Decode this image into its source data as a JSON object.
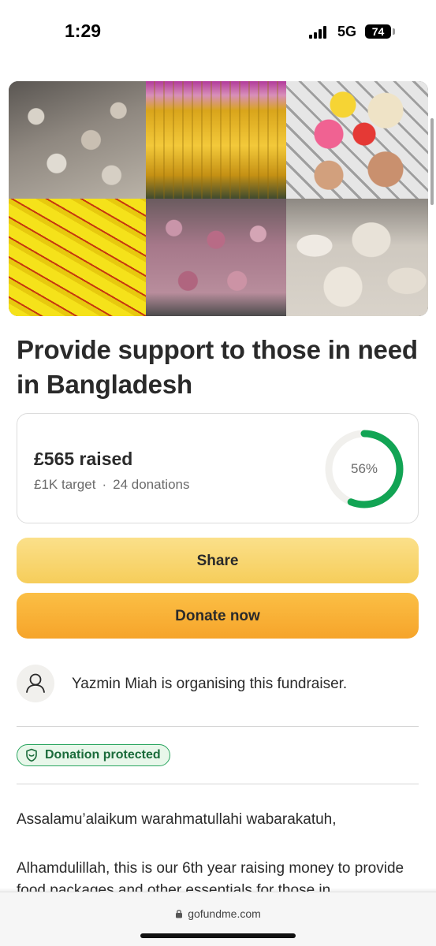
{
  "status_bar": {
    "time": "1:29",
    "network": "5G",
    "battery": "74"
  },
  "gallery": {
    "photos": [
      {
        "icon": "bags-of-garlic-photo"
      },
      {
        "icon": "bottles-of-oil-photo"
      },
      {
        "icon": "food-package-items-photo"
      },
      {
        "icon": "yellow-packets-photo"
      },
      {
        "icon": "bags-of-onions-photo"
      },
      {
        "icon": "sacks-of-rice-photo"
      }
    ]
  },
  "campaign": {
    "title": "Provide support to those in need in Bangladesh"
  },
  "progress": {
    "raised": "£565 raised",
    "target": "£1K target",
    "separator": "·",
    "donations": "24 donations",
    "percent_label": "56%",
    "percent_value": 0.56,
    "ring_color": "#12a454",
    "ring_track_color": "#f1f0ed"
  },
  "actions": {
    "share_label": "Share",
    "donate_label": "Donate now"
  },
  "organiser": {
    "text": "Yazmin Miah is organising this fundraiser."
  },
  "badge": {
    "label": "Donation protected"
  },
  "story": {
    "paragraph_1": "Assalamu’alaikum warahmatullahi wabarakatuh,",
    "paragraph_2": "Alhamdulillah, this is our 6th year raising money to provide food packages and other essentials for those in"
  },
  "browser": {
    "url": "gofundme.com"
  }
}
